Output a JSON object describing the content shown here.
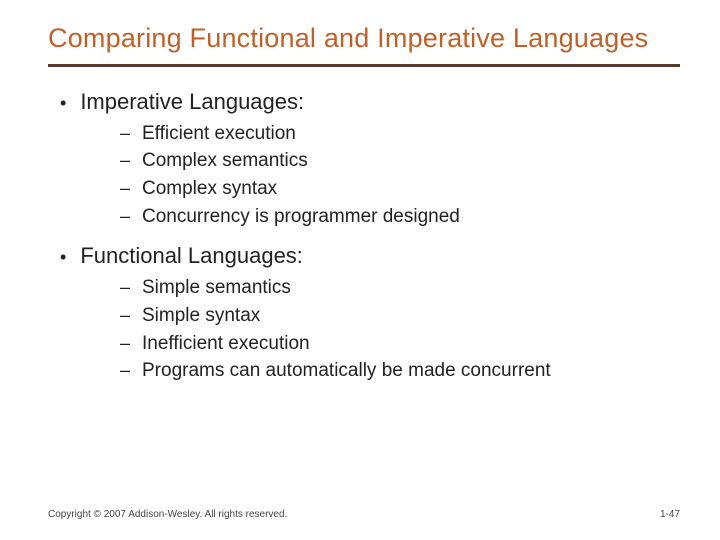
{
  "title": "Comparing Functional and Imperative Languages",
  "sections": [
    {
      "heading": "Imperative Languages:",
      "items": [
        "Efficient execution",
        "Complex semantics",
        "Complex syntax",
        "Concurrency is programmer designed"
      ]
    },
    {
      "heading": "Functional Languages:",
      "items": [
        "Simple semantics",
        "Simple syntax",
        "Inefficient execution",
        "Programs can automatically be made concurrent"
      ]
    }
  ],
  "footer": {
    "copyright": "Copyright © 2007 Addison-Wesley. All rights reserved.",
    "page": "1-47"
  }
}
